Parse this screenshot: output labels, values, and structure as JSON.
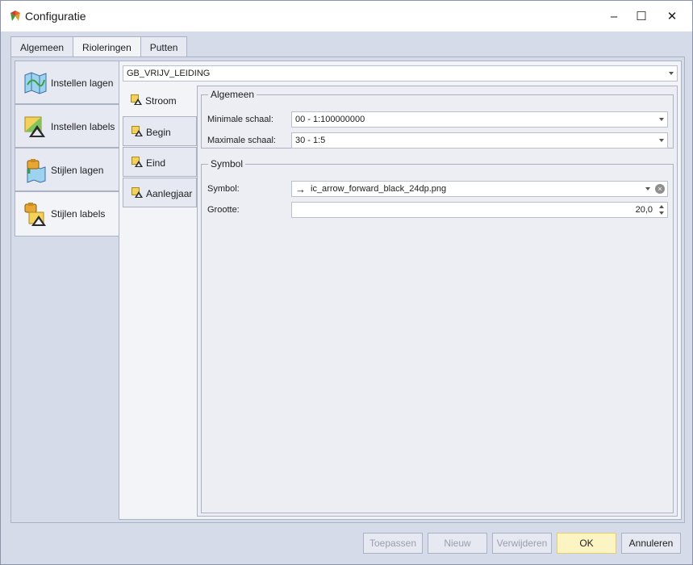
{
  "window": {
    "title": "Configuratie",
    "minimize_glyph": "–",
    "maximize_glyph": "☐",
    "close_glyph": "✕"
  },
  "top_tabs": [
    {
      "label": "Algemeen",
      "active": false
    },
    {
      "label": "Rioleringen",
      "active": true
    },
    {
      "label": "Putten",
      "active": false
    }
  ],
  "side_tabs": [
    {
      "label": "Instellen lagen",
      "icon": "map-icon",
      "active": false
    },
    {
      "label": "Instellen labels",
      "icon": "label-settings-icon",
      "active": false
    },
    {
      "label": "Stijlen lagen",
      "icon": "paint-layers-icon",
      "active": false
    },
    {
      "label": "Stijlen labels",
      "icon": "paint-labels-icon",
      "active": true
    }
  ],
  "layer_select": {
    "value": "GB_VRIJV_LEIDING"
  },
  "sub_tabs": [
    {
      "label": "Stroom",
      "icon": "label-style-icon",
      "active": true
    },
    {
      "label": "Begin",
      "icon": "label-style-icon",
      "active": false
    },
    {
      "label": "Eind",
      "icon": "label-style-icon",
      "active": false
    },
    {
      "label": "Aanlegjaar",
      "icon": "label-style-icon",
      "active": false
    }
  ],
  "group_algemeen": {
    "title": "Algemeen",
    "min_scale_label": "Minimale schaal:",
    "min_scale_value": "00 - 1:100000000",
    "max_scale_label": "Maximale schaal:",
    "max_scale_value": "30 - 1:5"
  },
  "group_symbol": {
    "title": "Symbol",
    "symbol_label": "Symbol:",
    "symbol_glyph": "→",
    "symbol_value": "ic_arrow_forward_black_24dp.png",
    "size_label": "Grootte:",
    "size_value": "20,0"
  },
  "buttons": {
    "apply": "Toepassen",
    "new": "Nieuw",
    "delete": "Verwijderen",
    "ok": "OK",
    "cancel": "Annuleren"
  }
}
